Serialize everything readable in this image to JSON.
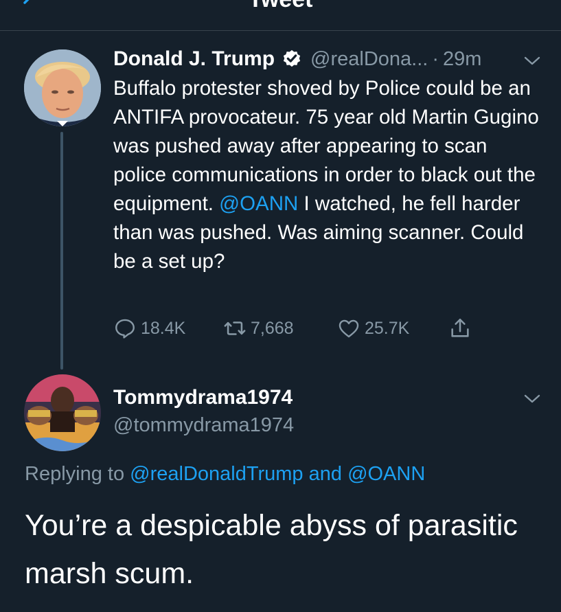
{
  "header": {
    "title": "Tweet",
    "back_icon": "chevron-left-icon"
  },
  "colors": {
    "background": "#15202b",
    "accent": "#1da1f2",
    "secondary_text": "#8899a6",
    "divider": "#38444d"
  },
  "tweet": {
    "author_name": "Donald J. Trump",
    "verified": true,
    "handle": "@realDona...",
    "dot": "·",
    "time": "29m",
    "body_part1": "Buffalo protester shoved by Police could be an ANTIFA provocateur. 75 year old Martin Gugino was pushed away after appearing to scan police communications in order to black out the equipment. ",
    "mention": "@OANN",
    "body_part2": " I watched, he fell harder than was pushed. Was aiming scanner. Could be a set up?",
    "actions": {
      "replies": "18.4K",
      "retweets": "7,668",
      "likes": "25.7K"
    }
  },
  "reply": {
    "author_name": "Tommydrama1974",
    "handle": "@tommydrama1974",
    "replying_prefix": "Replying to ",
    "replying_mention1": "@realDonaldTrump",
    "replying_and": " and ",
    "replying_mention2": "@OANN",
    "text": "You’re a despicable abyss of parasitic marsh scum."
  }
}
